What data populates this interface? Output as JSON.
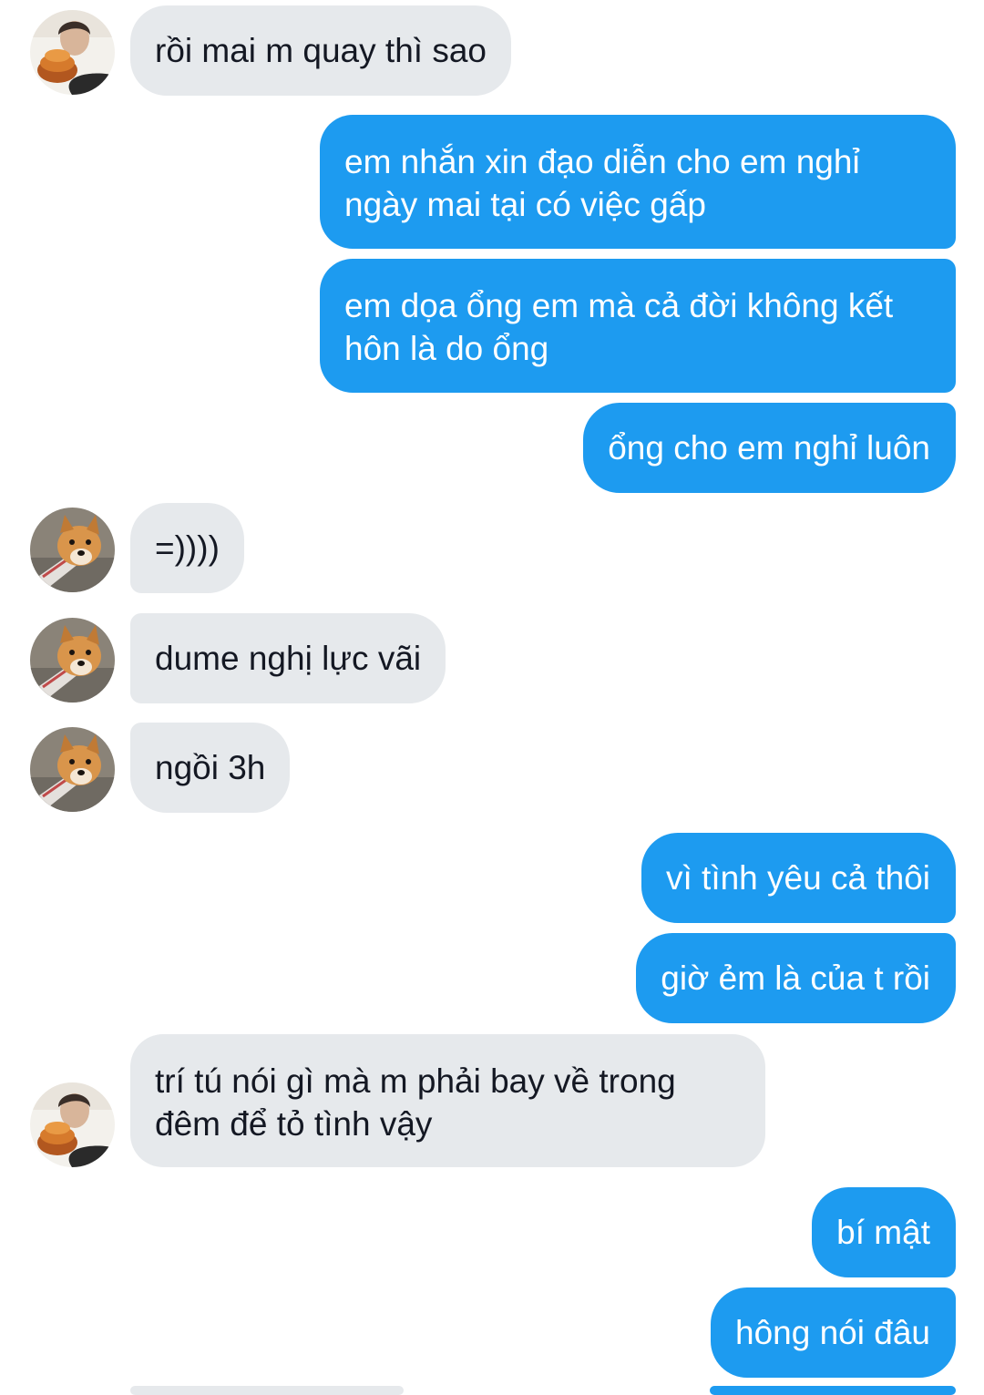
{
  "conversation": {
    "messages": [
      {
        "sender": "them",
        "text": "rồi mai m quay thì sao"
      },
      {
        "sender": "me",
        "text": "em nhắn xin đạo diễn cho em nghỉ ngày mai tại có việc gấp"
      },
      {
        "sender": "me",
        "text": "em dọa ổng em mà cả đời không kết hôn là do ổng"
      },
      {
        "sender": "me",
        "text": "ổng cho em nghỉ luôn"
      },
      {
        "sender": "them",
        "text": "=))))"
      },
      {
        "sender": "them",
        "text": "dume nghị lực vãi"
      },
      {
        "sender": "them",
        "text": "ngồi 3h"
      },
      {
        "sender": "me",
        "text": "vì tình yêu cả thôi"
      },
      {
        "sender": "me",
        "text": "giờ ẻm là của t rồi"
      },
      {
        "sender": "them",
        "text": "trí tú nói gì mà m phải bay về trong đêm để tỏ tình vậy"
      },
      {
        "sender": "me",
        "text": "bí mật"
      },
      {
        "sender": "me",
        "text": "hông nói đâu"
      }
    ],
    "avatars": {
      "person": "person-photo-avatar",
      "dog": "shiba-dog-photo-avatar"
    }
  },
  "colors": {
    "incoming_bubble": "#e6e9ec",
    "incoming_text": "#141823",
    "outgoing_bubble": "#1d9bf0",
    "outgoing_text": "#ffffff",
    "background": "#ffffff"
  }
}
